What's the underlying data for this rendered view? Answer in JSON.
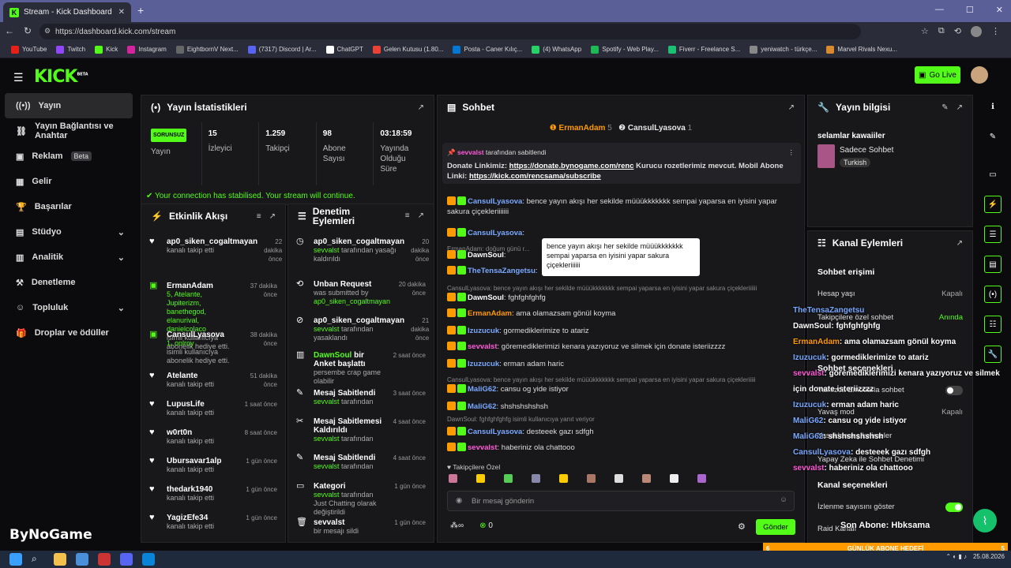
{
  "browser": {
    "tab_title": "Stream - Kick Dashboard",
    "url": "https://dashboard.kick.com/stream",
    "bookmarks": [
      {
        "label": "YouTube",
        "color": "#e62117"
      },
      {
        "label": "Twitch",
        "color": "#9146ff"
      },
      {
        "label": "Kick",
        "color": "#53fc18"
      },
      {
        "label": "Instagram",
        "color": "#d6249f"
      },
      {
        "label": "EightbornV Next...",
        "color": "#666666"
      },
      {
        "label": "(7317) Discord | Ar...",
        "color": "#5865f2"
      },
      {
        "label": "ChatGPT",
        "color": "#ffffff"
      },
      {
        "label": "Gelen Kutusu (1.80...",
        "color": "#ea4335"
      },
      {
        "label": "Posta - Caner Kılıç...",
        "color": "#0078d4"
      },
      {
        "label": "(4) WhatsApp",
        "color": "#25d366"
      },
      {
        "label": "Spotify - Web Play...",
        "color": "#1db954"
      },
      {
        "label": "Fiverr - Freelance S...",
        "color": "#1dbf73"
      },
      {
        "label": "yeniwatch - türkçe...",
        "color": "#888888"
      },
      {
        "label": "Marvel Rivals Nexu...",
        "color": "#d98a2e"
      }
    ]
  },
  "app": {
    "logo": "KICK",
    "logo_sup": "BETA",
    "go_live": "Go Live"
  },
  "sidebar": [
    {
      "label": "Yayın",
      "icon": "broadcast-icon",
      "active": true
    },
    {
      "label": "Yayın Bağlantısı ve Anahtar",
      "icon": "link-icon"
    },
    {
      "label": "Reklam",
      "icon": "ad-icon",
      "badge": "Beta"
    },
    {
      "label": "Gelir",
      "icon": "revenue-icon"
    },
    {
      "label": "Başarılar",
      "icon": "trophy-icon"
    },
    {
      "label": "Stüdyo",
      "icon": "studio-icon",
      "chevron": true
    },
    {
      "label": "Analitik",
      "icon": "chart-icon",
      "chevron": true
    },
    {
      "label": "Denetleme",
      "icon": "gavel-icon"
    },
    {
      "label": "Topluluk",
      "icon": "community-icon",
      "chevron": true
    },
    {
      "label": "Droplar ve ödüller",
      "icon": "gift-icon"
    }
  ],
  "watermark": "ByNoGame",
  "stats": {
    "title": "Yayın İstatistikleri",
    "status": "SORUNSUZ",
    "status_label": "Yayın",
    "cells": [
      {
        "value": "15",
        "label": "İzleyici"
      },
      {
        "value": "1.259",
        "label": "Takipçi"
      },
      {
        "value": "98",
        "label": "Abone Sayısı"
      },
      {
        "value": "03:18:59",
        "label": "Yayında Olduğu Süre"
      }
    ],
    "notice": "Your connection has stabilised. Your stream will continue."
  },
  "feed": {
    "title": "Etkinlik Akışı",
    "items": [
      {
        "name": "ap0_siken_cogaltmayan",
        "desc": "kanalı takip etti",
        "time": "22 dakika önce",
        "icon": "heart-icon"
      },
      {
        "name": "ErmanAdam",
        "desc": "5, Atelante, Jupiterizm, banethegod, elanurival, danielcolaco",
        "desc2": "isimli kullanıcıya abonelik hediye etti.",
        "time": "37 dakika önce",
        "icon": "gift-sub-icon"
      },
      {
        "name": "CansulLyasova",
        "desc": "1, onlroy",
        "desc2": "isimli kullanıcıya abonelik hediye etti.",
        "time": "38 dakika önce",
        "icon": "gift-sub-icon"
      },
      {
        "name": "Atelante",
        "desc": "kanalı takip etti",
        "time": "51 dakika önce",
        "icon": "heart-icon"
      },
      {
        "name": "LupusLife",
        "desc": "kanalı takip etti",
        "time": "1 saat önce",
        "icon": "heart-icon"
      },
      {
        "name": "w0rt0n",
        "desc": "kanalı takip etti",
        "time": "8 saat önce",
        "icon": "heart-icon"
      },
      {
        "name": "Ubursavar1alp",
        "desc": "kanalı takip etti",
        "time": "1 gün önce",
        "icon": "heart-icon"
      },
      {
        "name": "thedark1940",
        "desc": "kanalı takip etti",
        "time": "1 gün önce",
        "icon": "heart-icon"
      },
      {
        "name": "YagizEfe34",
        "desc": "kanalı takip etti",
        "time": "1 gün önce",
        "icon": "heart-icon"
      }
    ]
  },
  "mod": {
    "title": "Denetim Eylemleri",
    "items": [
      {
        "name": "ap0_siken_cogaltmayan",
        "desc_g": "sevvalst",
        "desc": "tarafından yasağı kaldırıldı",
        "time": "20 dakika önce",
        "icon": "clock-icon"
      },
      {
        "name": "Unban Request",
        "desc": "was submitted by",
        "desc_g": "ap0_siken_cogaltmayan",
        "time": "20 dakika önce",
        "icon": "history-icon"
      },
      {
        "name": "ap0_siken_cogaltmayan",
        "desc_g": "sevvalst",
        "desc": "tarafından yasaklandı",
        "time": "21 dakika önce",
        "icon": "ban-icon"
      },
      {
        "name": "DawnSoul",
        "name2": "bir Anket başlattı",
        "desc": "persembe crap game olabilir",
        "time": "2 saat önce",
        "icon": "poll-icon"
      },
      {
        "name": "Mesaj Sabitlendi",
        "desc_g": "sevvalst",
        "desc": "tarafından",
        "time": "3 saat önce",
        "icon": "pin-icon"
      },
      {
        "name": "Mesaj Sabitlemesi Kaldırıldı",
        "desc_g": "sevvalst",
        "desc": "tarafından",
        "time": "4 saat önce",
        "icon": "unpin-icon"
      },
      {
        "name": "Mesaj Sabitlendi",
        "desc_g": "sevvalst",
        "desc": "tarafından",
        "time": "4 saat önce",
        "icon": "pin-icon"
      },
      {
        "name": "Kategori",
        "desc_g": "sevvalst",
        "desc": "tarafından Just Chatting olarak değiştirildi",
        "time": "1 gün önce",
        "icon": "category-icon"
      },
      {
        "name": "sevvalst",
        "desc": "bir mesajı sildi",
        "time": "1 gün önce",
        "icon": "trash-icon"
      }
    ]
  },
  "chat": {
    "title": "Sohbet",
    "top": [
      {
        "name": "ErmanAdam",
        "count": "5"
      },
      {
        "name": "CansulLyasova",
        "count": "1"
      }
    ],
    "pinned_by": "sevvalst",
    "pinned_suffix": "tarafından sabitlendi",
    "pinned_text1": "Donate Linkimiz:",
    "pinned_link1": "https://donate.bynogame.com/renc",
    "pinned_text2": "Kurucu rozetlerimiz mevcut. Mobil Abone Linki:",
    "pinned_link2": "https://kick.com/rencsama/subscribe",
    "messages": [
      {
        "user": "CansulLyasova",
        "color": "#7aa8ff",
        "text": "bence yayın akışı her sekilde müüükkkkkkk sempai yaparsa en iyisini yapar sakura çiçekleriiiiiii"
      },
      {
        "user": "CansulLyasova",
        "color": "#7aa8ff",
        "text": ""
      },
      {
        "reply": "ErmanAdam: doğum günü r..."
      },
      {
        "user": "DawnSoul",
        "color": "#ffffff",
        "text": ""
      },
      {
        "user": "TheTensaZangetsu",
        "color": "#7aa8ff",
        "text": ""
      },
      {
        "reply": "CansulLyasova: bence yayın akışı her sekilde müüükkkkkkk sempai yaparsa en iyisini yapar sakura çiçekleriiiiii"
      },
      {
        "user": "DawnSoul",
        "color": "#ffffff",
        "text": "fghfghfghfg"
      },
      {
        "user": "ErmanAdam",
        "color": "#ff9a00",
        "text": "ama olamazsam gönül koyma"
      },
      {
        "user": "Izuzucuk",
        "color": "#7aa8ff",
        "text": "gormediklerimize to atariz"
      },
      {
        "user": "sevvalst",
        "color": "#ff5ad8",
        "text": "göremediklerimizi kenara yazıyoruz ve silmek için donate isteriizzzz"
      },
      {
        "user": "Izuzucuk",
        "color": "#7aa8ff",
        "text": "erman adam haric"
      },
      {
        "reply": "CansulLyasova: bence yayın akışı her sekilde müüükkkkkkk sempai yaparsa en iyisini yapar sakura çiçekleriiiii"
      },
      {
        "user": "MaliG62",
        "color": "#7aa8ff",
        "text": "cansu og yide istiyor"
      },
      {
        "user": "MaliG62",
        "color": "#7aa8ff",
        "text": "shshshshshsh"
      },
      {
        "reply": "DawnSoul: fghfghfghfg isimli kullanıcıya yanıt veriyor"
      },
      {
        "user": "CansulLyasova",
        "color": "#7aa8ff",
        "text": "desteeek gazı sdfgh"
      },
      {
        "user": "sevvalst",
        "color": "#ff5ad8",
        "text": "haberiniz ola chattooo"
      }
    ],
    "tooltip": "bence yayın akışı her sekilde müüükkkkkkk sempai yaparsa en iyisini yapar sakura çiçekleriiiiii",
    "followers_label": "Takipçilere Özel",
    "input_placeholder": "Bir mesaj gönderin",
    "send": "Gönder",
    "viewer_count": "0"
  },
  "info": {
    "title": "Yayın bilgisi",
    "stream_title": "selamlar kawaiiler",
    "category": "Sadece Sohbet",
    "language": "Turkish"
  },
  "actions": {
    "title": "Kanal Eylemleri",
    "section1": "Sohbet erişimi",
    "rows1": [
      {
        "label": "Hesap yaşı",
        "value": "Kapalı"
      },
      {
        "label": "Takipçilere özel sohbet",
        "value": "Anında"
      }
    ],
    "section2": "Sohbet seçenekleri",
    "rows2": [
      {
        "label": "Yalnızca Emotlarla sohbet",
        "value": ""
      },
      {
        "label": "Yavaş mod",
        "value": "Kapalı"
      },
      {
        "label": "Yasaklanmış kelimeler",
        "value": ""
      },
      {
        "label": "Yapay Zeka ile Sohbet Denetimi",
        "value": ""
      }
    ],
    "section3": "Kanal seçenekleri",
    "rows3": [
      {
        "label": "İzlenme sayısını göster",
        "value": ""
      },
      {
        "label": "Raid Kanalı",
        "value": ""
      }
    ]
  },
  "overlay": {
    "lines": [
      {
        "u": "TheTensaZangetsu",
        "c": "#7aa8ff",
        "t": ""
      },
      {
        "u": "DawnSoul",
        "c": "#ffffff",
        "t": ": fghfghfghfg"
      },
      {
        "u": "ErmanAdam",
        "c": "#ff9a00",
        "t": ": ama olamazsam gönül koyma"
      },
      {
        "u": "Izuzucuk",
        "c": "#7aa8ff",
        "t": ": gormediklerimize to atariz"
      },
      {
        "u": "sevvalst",
        "c": "#ff5ad8",
        "t": ": göremediklerimizi kenara yazıyoruz ve silmek için donate isteriizzzz"
      },
      {
        "u": "Izuzucuk",
        "c": "#7aa8ff",
        "t": ": erman adam haric"
      },
      {
        "u": "MaliG62",
        "c": "#7aa8ff",
        "t": ": cansu og yide istiyor"
      },
      {
        "u": "MaliG62",
        "c": "#7aa8ff",
        "t": ": shshshshshsh"
      },
      {
        "u": "CansulLyasova",
        "c": "#7aa8ff",
        "t": ": desteeek gazı sdfgh"
      },
      {
        "u": "sevvalst",
        "c": "#ff5ad8",
        "t": ": haberiniz ola chattooo"
      }
    ],
    "last_sub": "Son Abone: Hbksama",
    "goal_left": "6",
    "goal_label": "GÜNLÜK ABONE HEDEFİ",
    "goal_right": "5"
  },
  "taskbar": {
    "date": "25.08.2026"
  }
}
